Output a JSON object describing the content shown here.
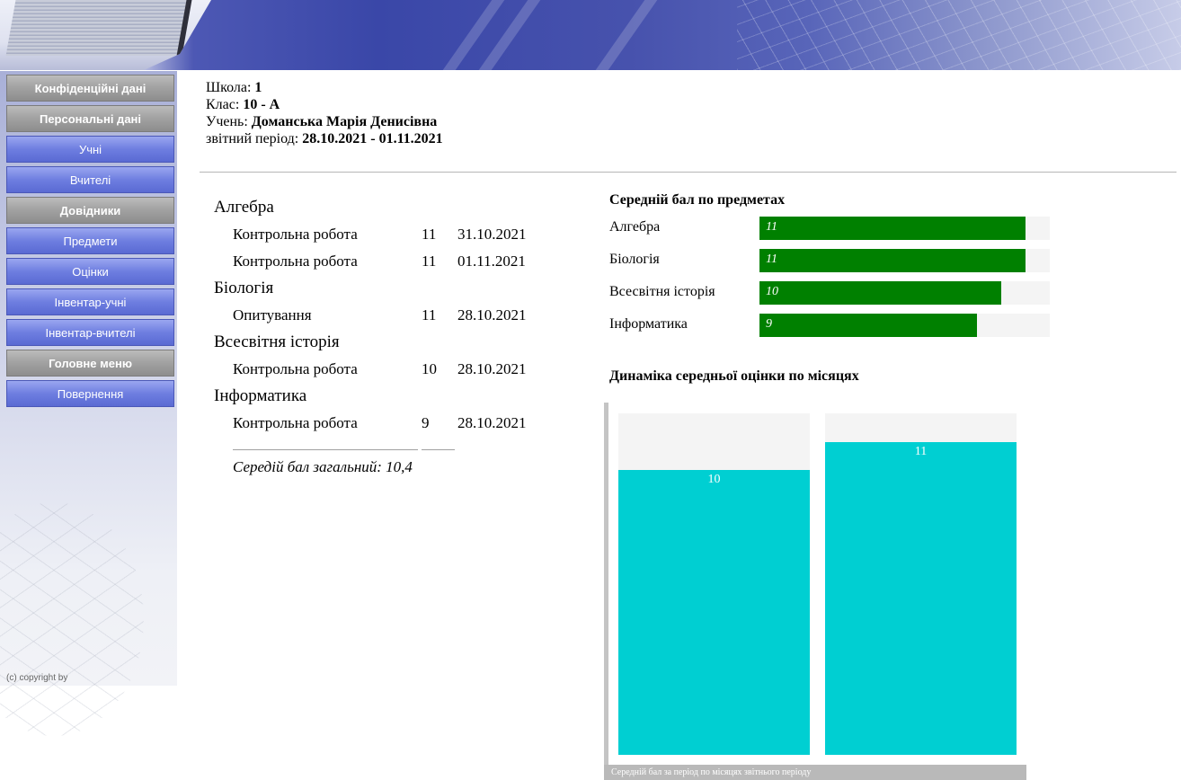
{
  "sidebar": {
    "items": [
      {
        "label": "Конфіденційні дані",
        "kind": "section"
      },
      {
        "label": "Персональні дані",
        "kind": "section"
      },
      {
        "label": "Учні",
        "kind": "item"
      },
      {
        "label": "Вчителі",
        "kind": "item"
      },
      {
        "label": "Довідники",
        "kind": "section"
      },
      {
        "label": "Предмети",
        "kind": "item"
      },
      {
        "label": "Оцінки",
        "kind": "item"
      },
      {
        "label": "Інвентар-учні",
        "kind": "item"
      },
      {
        "label": "Інвентар-вчителі",
        "kind": "item"
      },
      {
        "label": "Головне меню",
        "kind": "section"
      },
      {
        "label": "Повернення",
        "kind": "item"
      }
    ],
    "copyright": "(c) copyright by"
  },
  "info": {
    "school_label": "Школа:",
    "school_value": "1",
    "class_label": "Клас:",
    "class_value": "10 - А",
    "student_label": "Учень:",
    "student_value": "Доманська Марія Денисівна",
    "period_label": "звітний період:",
    "period_value": "28.10.2021 - 01.11.2021"
  },
  "grades": {
    "subjects": [
      {
        "name": "Алгебра",
        "entries": [
          {
            "type": "Контрольна робота",
            "mark": "11",
            "date": "31.10.2021"
          },
          {
            "type": "Контрольна робота",
            "mark": "11",
            "date": "01.11.2021"
          }
        ]
      },
      {
        "name": "Біологія",
        "entries": [
          {
            "type": "Опитування",
            "mark": "11",
            "date": "28.10.2021"
          }
        ]
      },
      {
        "name": "Всесвітня історія",
        "entries": [
          {
            "type": "Контрольна робота",
            "mark": "10",
            "date": "28.10.2021"
          }
        ]
      },
      {
        "name": "Інформатика",
        "entries": [
          {
            "type": "Контрольна робота",
            "mark": "9",
            "date": "28.10.2021"
          }
        ]
      }
    ],
    "average_label": "Середій бал загальний:",
    "average_value": "10,4"
  },
  "colors": {
    "subject_bar": "#008000",
    "month_bar": "#00cfd2",
    "track": "#f4f4f4",
    "nav_section": "#a3a3a3",
    "nav_item": "#6e7ee0"
  },
  "chart_data": [
    {
      "type": "bar",
      "orientation": "horizontal",
      "title": "Середній бал по предметах",
      "categories": [
        "Алгебра",
        "Біологія",
        "Всесвітня історія",
        "Інформатика"
      ],
      "values": [
        11,
        11,
        10,
        9
      ],
      "xlim": [
        0,
        12
      ],
      "grid": false
    },
    {
      "type": "bar",
      "orientation": "vertical",
      "title": "Динаміка середньої оцінки по місяцях",
      "values": [
        10,
        11
      ],
      "ylim": [
        0,
        12
      ],
      "xlabel": "Середній бал за період по місяцях звітнього періоду",
      "grid": false
    }
  ]
}
